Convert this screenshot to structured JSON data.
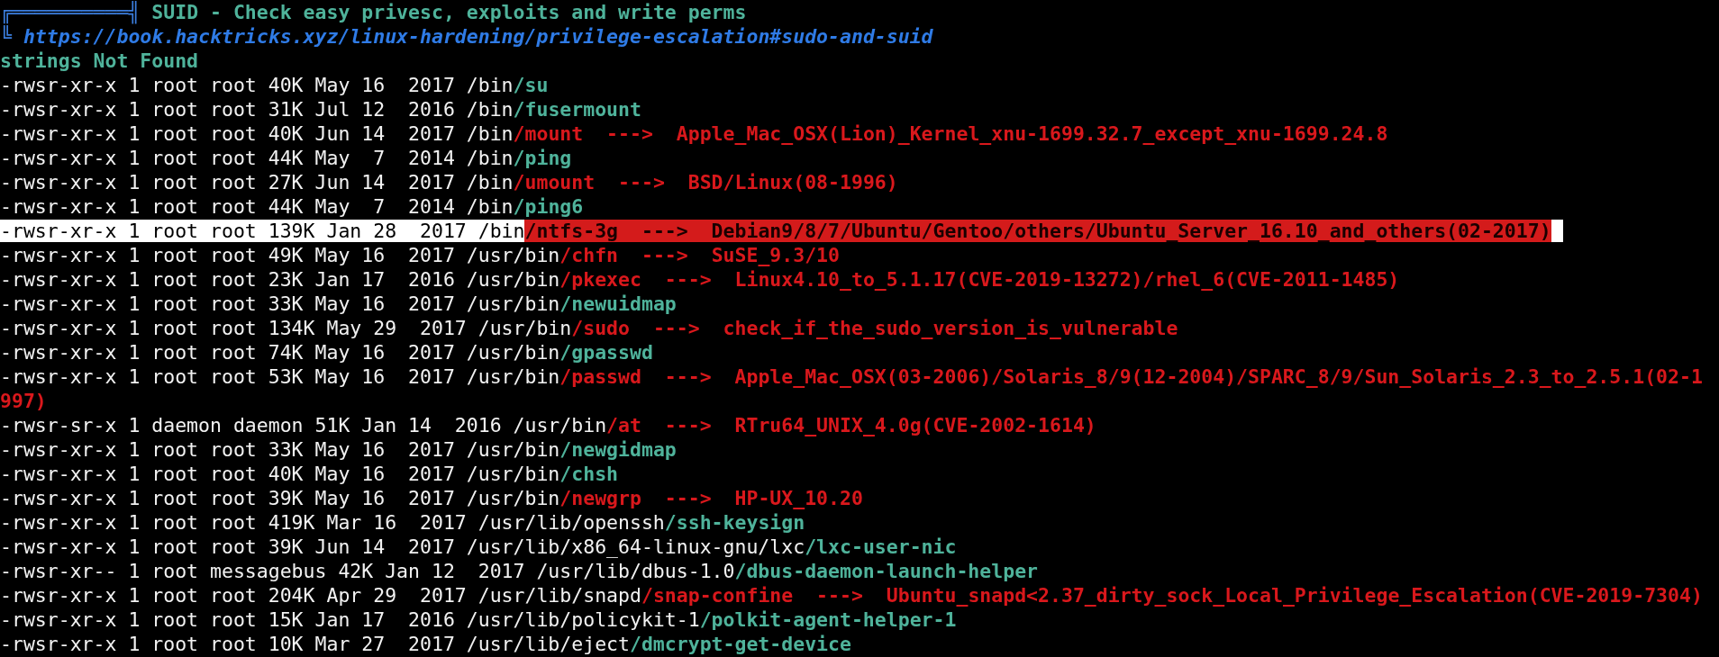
{
  "header": {
    "frame": "╔══════════╣",
    "title": "SUID - Check easy privesc, exploits and write perms",
    "corner": "╚",
    "link": "https://book.hacktricks.xyz/linux-hardening/privilege-escalation#sudo-and-suid"
  },
  "notice": "strings Not Found",
  "lines": [
    {
      "prefix": "-rwsr-xr-x 1 root root 40K May 16  2017 /bin",
      "file": "/su",
      "highlighted": false
    },
    {
      "prefix": "-rwsr-xr-x 1 root root 31K Jul 12  2016 /bin",
      "file": "/fusermount",
      "highlighted": false
    },
    {
      "prefix": "-rwsr-xr-x 1 root root 40K Jun 14  2017 /bin",
      "file": "/mount",
      "arrow": "--->",
      "exploit": "Apple_Mac_OSX(Lion)_Kernel_xnu-1699.32.7_except_xnu-1699.24.8",
      "highlighted": false
    },
    {
      "prefix": "-rwsr-xr-x 1 root root 44K May  7  2014 /bin",
      "file": "/ping",
      "highlighted": false
    },
    {
      "prefix": "-rwsr-xr-x 1 root root 27K Jun 14  2017 /bin",
      "file": "/umount",
      "arrow": "--->",
      "exploit": "BSD/Linux(08-1996)",
      "highlighted": false
    },
    {
      "prefix": "-rwsr-xr-x 1 root root 44K May  7  2014 /bin",
      "file": "/ping6",
      "highlighted": false
    },
    {
      "prefix": "-rwsr-xr-x 1 root root 139K Jan 28  2017 /bin",
      "file": "/ntfs-3g",
      "arrow": "--->",
      "exploit": "Debian9/8/7/Ubuntu/Gentoo/others/Ubuntu_Server_16.10_and_others(02-2017)",
      "highlighted": true
    },
    {
      "prefix": "-rwsr-xr-x 1 root root 49K May 16  2017 /usr/bin",
      "file": "/chfn",
      "arrow": "--->",
      "exploit": "SuSE_9.3/10",
      "highlighted": false
    },
    {
      "prefix": "-rwsr-xr-x 1 root root 23K Jan 17  2016 /usr/bin",
      "file": "/pkexec",
      "arrow": "--->",
      "exploit": "Linux4.10_to_5.1.17(CVE-2019-13272)/rhel_6(CVE-2011-1485)",
      "highlighted": false
    },
    {
      "prefix": "-rwsr-xr-x 1 root root 33K May 16  2017 /usr/bin",
      "file": "/newuidmap",
      "highlighted": false
    },
    {
      "prefix": "-rwsr-xr-x 1 root root 134K May 29  2017 /usr/bin",
      "file": "/sudo",
      "arrow": "--->",
      "exploit": "check_if_the_sudo_version_is_vulnerable",
      "highlighted": false
    },
    {
      "prefix": "-rwsr-xr-x 1 root root 74K May 16  2017 /usr/bin",
      "file": "/gpasswd",
      "highlighted": false
    },
    {
      "prefix": "-rwsr-xr-x 1 root root 53K May 16  2017 /usr/bin",
      "file": "/passwd",
      "arrow": "--->",
      "exploit": "Apple_Mac_OSX(03-2006)/Solaris_8/9(12-2004)/SPARC_8/9/Sun_Solaris_2.3_to_2.5.1(02-1",
      "continuation": "997)",
      "highlighted": false
    },
    {
      "prefix": "-rwsr-sr-x 1 daemon daemon 51K Jan 14  2016 /usr/bin",
      "file": "/at",
      "arrow": "--->",
      "exploit": "RTru64_UNIX_4.0g(CVE-2002-1614)",
      "highlighted": false
    },
    {
      "prefix": "-rwsr-xr-x 1 root root 33K May 16  2017 /usr/bin",
      "file": "/newgidmap",
      "highlighted": false
    },
    {
      "prefix": "-rwsr-xr-x 1 root root 40K May 16  2017 /usr/bin",
      "file": "/chsh",
      "highlighted": false
    },
    {
      "prefix": "-rwsr-xr-x 1 root root 39K May 16  2017 /usr/bin",
      "file": "/newgrp",
      "arrow": "--->",
      "exploit": "HP-UX_10.20",
      "highlighted": false
    },
    {
      "prefix": "-rwsr-xr-x 1 root root 419K Mar 16  2017 /usr/lib/openssh",
      "file": "/ssh-keysign",
      "highlighted": false
    },
    {
      "prefix": "-rwsr-xr-x 1 root root 39K Jun 14  2017 /usr/lib/x86_64-linux-gnu/lxc",
      "file": "/lxc-user-nic",
      "highlighted": false
    },
    {
      "prefix": "-rwsr-xr-- 1 root messagebus 42K Jan 12  2017 /usr/lib/dbus-1.0",
      "file": "/dbus-daemon-launch-helper",
      "highlighted": false
    },
    {
      "prefix": "-rwsr-xr-x 1 root root 204K Apr 29  2017 /usr/lib/snapd",
      "file": "/snap-confine",
      "arrow": "--->",
      "exploit": "Ubuntu_snapd<2.37_dirty_sock_Local_Privilege_Escalation(CVE-2019-7304)",
      "highlighted": false
    },
    {
      "prefix": "-rwsr-xr-x 1 root root 15K Jan 17  2016 /usr/lib/policykit-1",
      "file": "/polkit-agent-helper-1",
      "highlighted": false
    },
    {
      "prefix": "-rwsr-xr-x 1 root root 10K Mar 27  2017 /usr/lib/eject",
      "file": "/dmcrypt-get-device",
      "highlighted": false
    }
  ]
}
